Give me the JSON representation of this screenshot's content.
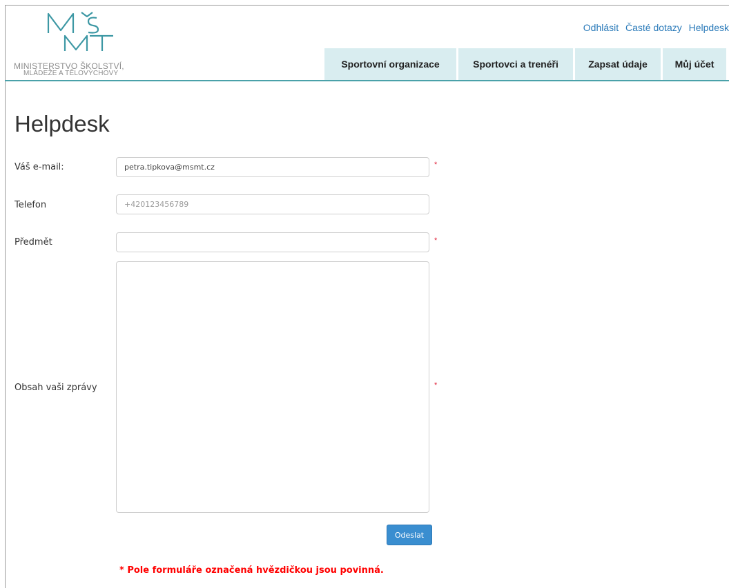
{
  "logo": {
    "name": "MŠMT",
    "line1": "MINISTERSTVO ŠKOLSTVÍ,",
    "line2": "MLÁDEŽE A TĚLOVÝCHOVY"
  },
  "top_links": {
    "logout": "Odhlásit",
    "faq": "Časté dotazy",
    "helpdesk": "Helpdesk"
  },
  "nav": {
    "items": [
      {
        "label": "Sportovní organizace"
      },
      {
        "label": "Sportovci a trenéři"
      },
      {
        "label": "Zapsat údaje"
      },
      {
        "label": "Můj účet"
      }
    ]
  },
  "page": {
    "title": "Helpdesk"
  },
  "form": {
    "email": {
      "label": "Váš e-mail:",
      "value": "petra.tipkova@msmt.cz",
      "required": true
    },
    "phone": {
      "label": "Telefon",
      "placeholder": "+420123456789",
      "required": false
    },
    "subject": {
      "label": "Předmět",
      "value": "",
      "required": true
    },
    "message": {
      "label": "Obsah vaši zprávy",
      "value": "",
      "required": true
    },
    "required_mark": "*",
    "submit_label": "Odeslat",
    "required_note": "* Pole formuláře označená hvězdičkou jsou povinná."
  },
  "colors": {
    "link": "#2a7ab9",
    "nav_bg": "#d9edf0",
    "accent_line": "#4aa1a9",
    "logo_teal": "#3d98a4",
    "button": "#3a8ed0",
    "required": "#ff0000"
  }
}
